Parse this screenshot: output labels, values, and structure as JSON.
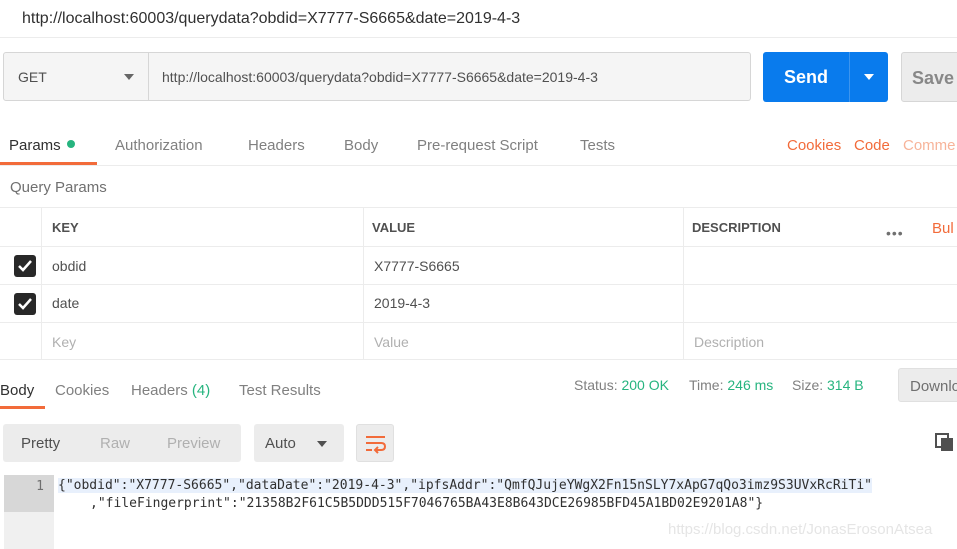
{
  "window": {
    "title": "http://localhost:60003/querydata?obdid=X7777-S6665&date=2019-4-3"
  },
  "request": {
    "method": "GET",
    "url": "http://localhost:60003/querydata?obdid=X7777-S6665&date=2019-4-3",
    "send_label": "Send",
    "save_label": "Save"
  },
  "request_tabs": {
    "params": "Params",
    "authorization": "Authorization",
    "headers": "Headers",
    "body": "Body",
    "pre_request": "Pre-request Script",
    "tests": "Tests",
    "cookies": "Cookies",
    "code": "Code",
    "comments": "Comme"
  },
  "query_params": {
    "title": "Query Params",
    "columns": {
      "key": "KEY",
      "value": "VALUE",
      "description": "DESCRIPTION"
    },
    "more": "•••",
    "bulk_edit": "Bul",
    "rows": [
      {
        "key": "obdid",
        "value": "X7777-S6665",
        "checked": true
      },
      {
        "key": "date",
        "value": "2019-4-3",
        "checked": true
      }
    ],
    "placeholders": {
      "key": "Key",
      "value": "Value",
      "description": "Description"
    }
  },
  "response_tabs": {
    "body": "Body",
    "cookies": "Cookies",
    "headers": "Headers",
    "headers_count": "(4)",
    "test_results": "Test Results"
  },
  "status": {
    "status_label": "Status:",
    "status_value": "200 OK",
    "time_label": "Time:",
    "time_value": "246 ms",
    "size_label": "Size:",
    "size_value": "314 B",
    "download": "Downlo"
  },
  "view": {
    "pretty": "Pretty",
    "raw": "Raw",
    "preview": "Preview",
    "format": "Auto"
  },
  "code": {
    "line_number": "1",
    "line1": "{\"obdid\":\"X7777-S6665\",\"dataDate\":\"2019-4-3\",\"ipfsAddr\":\"QmfQJujeYWgX2Fn15nSLY7xApG7qQo3imz9S3UVxRcRiTi\"",
    "line2": ",\"fileFingerprint\":\"21358B2F61C5B5DDD515F7046765BA43E8B643DCE26985BFD45A1BD02E9201A8\"}"
  },
  "watermark": "https://blog.csdn.net/JonasErosonAtsea",
  "colors": {
    "accent": "#f26b3a",
    "primary": "#097bed",
    "success": "#26b47f"
  }
}
